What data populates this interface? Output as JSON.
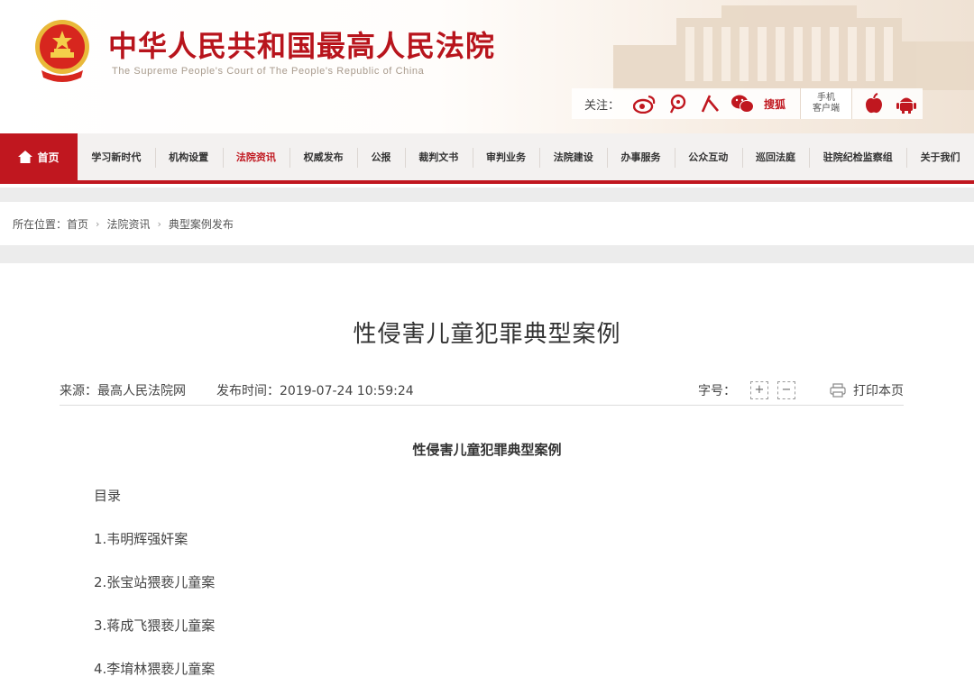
{
  "header": {
    "site_title": "中华人民共和国最高人民法院",
    "site_subtitle": "The Supreme People's Court of The People's Republic of China",
    "follow_label": "关注：",
    "follow_icons": [
      "weibo-icon",
      "tencent-weibo-icon",
      "renmin-icon",
      "wechat-icon"
    ],
    "baidu_label": "搜狐",
    "mobile_line1": "手机",
    "mobile_line2": "客户端",
    "app_icons": [
      "apple-icon",
      "android-icon"
    ]
  },
  "nav": {
    "home": "首页",
    "items": [
      {
        "label": "学习新时代"
      },
      {
        "label": "机构设置"
      },
      {
        "label": "法院资讯",
        "active": true
      },
      {
        "label": "权威发布"
      },
      {
        "label": "公报"
      },
      {
        "label": "裁判文书"
      },
      {
        "label": "审判业务"
      },
      {
        "label": "法院建设"
      },
      {
        "label": "办事服务"
      },
      {
        "label": "公众互动"
      },
      {
        "label": "巡回法庭"
      },
      {
        "label": "驻院纪检监察组"
      },
      {
        "label": "关于我们"
      }
    ]
  },
  "breadcrumb": {
    "prefix": "所在位置：",
    "items": [
      "首页",
      "法院资讯",
      "典型案例发布"
    ]
  },
  "article": {
    "title": "性侵害儿童犯罪典型案例",
    "source": "来源：最高人民法院网",
    "publish_time": "发布时间：2019-07-24 10:59:24",
    "font_size_label": "字号：",
    "font_plus": "+",
    "font_minus": "−",
    "print_label": "打印本页",
    "subtitle": "性侵害儿童犯罪典型案例",
    "toc": [
      "目录",
      "1.韦明辉强奸案",
      "2.张宝站猥亵儿童案",
      "3.蒋成飞猥亵儿童案",
      "4.李堉林猥亵儿童案"
    ]
  },
  "colors": {
    "brand_red": "#c0171f",
    "nav_bg": "#f3f1f0"
  }
}
